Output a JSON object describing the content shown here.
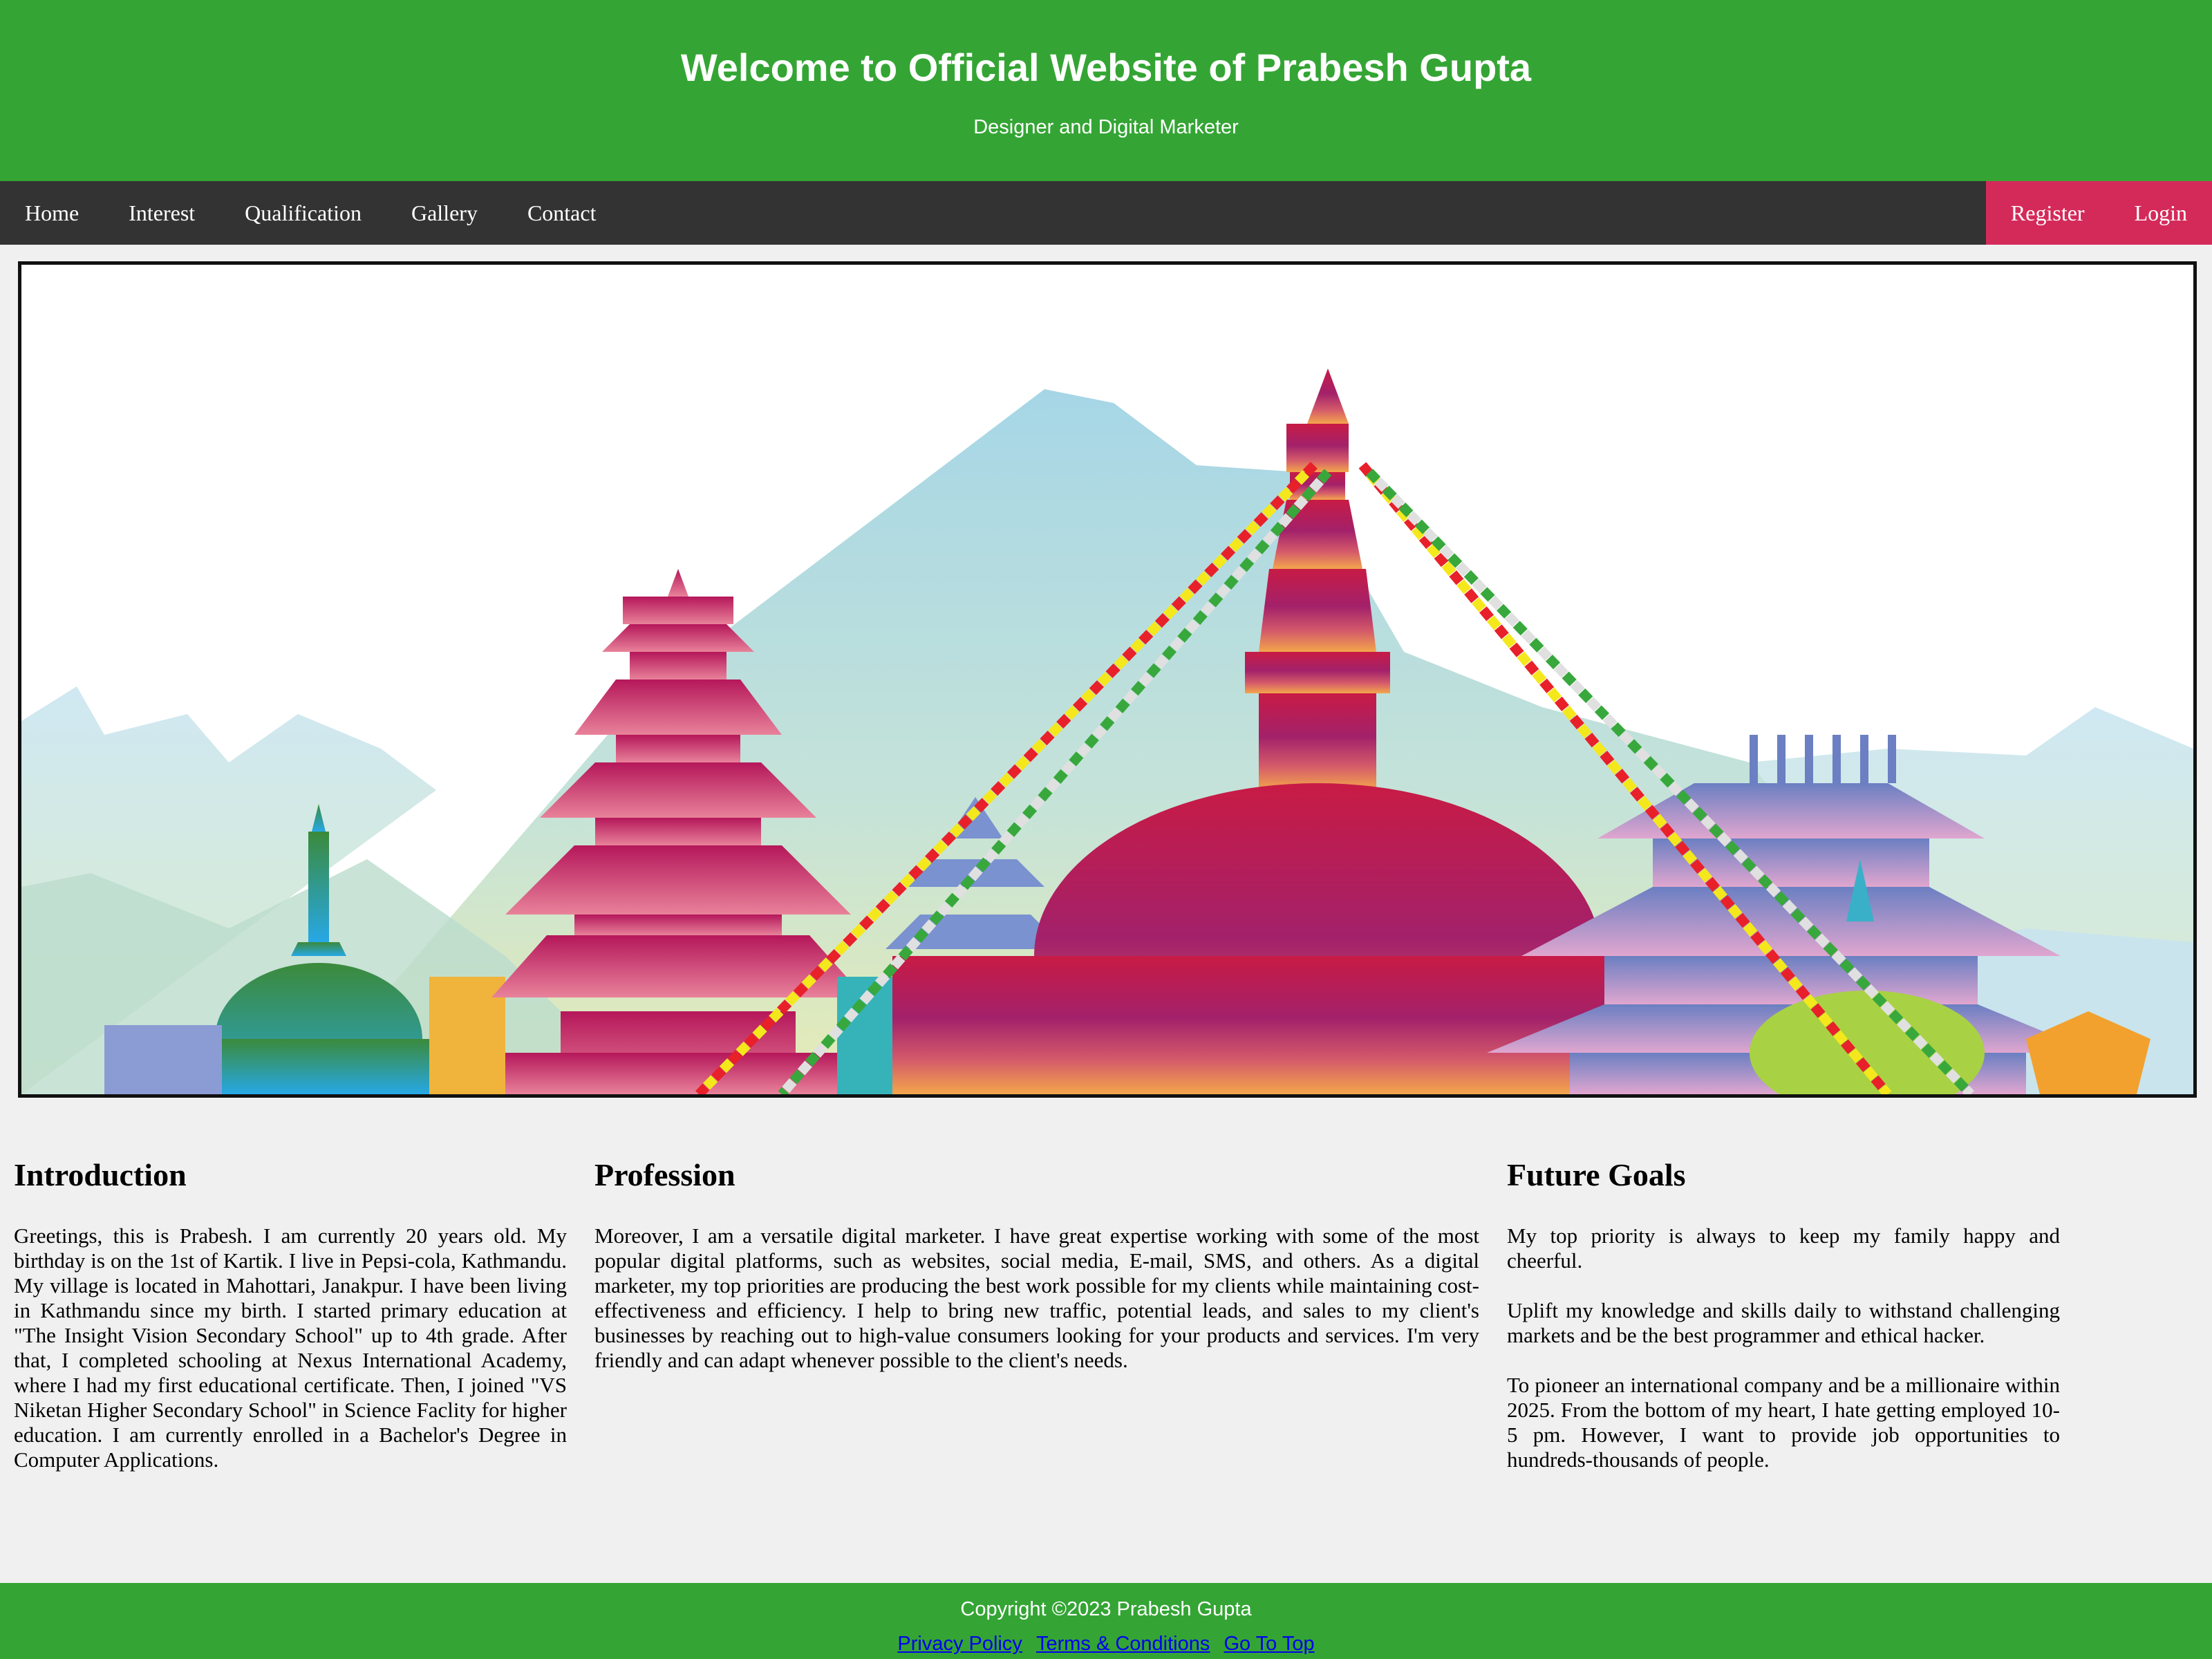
{
  "header": {
    "title": "Welcome to Official Website of Prabesh Gupta",
    "subtitle": "Designer and Digital Marketer"
  },
  "nav": {
    "left": [
      "Home",
      "Interest",
      "Qualification",
      "Gallery",
      "Contact"
    ],
    "right": [
      "Register",
      "Login"
    ]
  },
  "banner": {
    "icon": "kathmandu-skyline-illustration"
  },
  "sections": {
    "introduction": {
      "heading": "Introduction",
      "paragraphs": [
        "Greetings, this is Prabesh. I am currently 20 years old. My birthday is on the 1st of Kartik. I live in Pepsi-cola, Kathmandu. My village is located in Mahottari, Janakpur. I have been living in Kathmandu since my birth. I started primary education at \"The Insight Vision Secondary School\" up to 4th grade. After that, I completed schooling at Nexus International Academy, where I had my first educational certificate. Then, I joined \"VS Niketan Higher Secondary School\" in Science Faclity for higher education. I am currently enrolled in a Bachelor's Degree in Computer Applications."
      ]
    },
    "profession": {
      "heading": "Profession",
      "paragraphs": [
        "Moreover, I am a versatile digital marketer. I have great expertise working with some of the most popular digital platforms, such as websites, social media, E-mail, SMS, and others. As a digital marketer, my top priorities are producing the best work possible for my clients while maintaining cost-effectiveness and efficiency. I help to bring new traffic, potential leads, and sales to my client's businesses by reaching out to high-value consumers looking for your products and services. I'm very friendly and can adapt whenever possible to the client's needs."
      ]
    },
    "goals": {
      "heading": "Future Goals",
      "paragraphs": [
        "My top priority is always to keep my family happy and cheerful.",
        "Uplift my knowledge and skills daily to withstand challenging markets and be the best programmer and ethical hacker.",
        "To pioneer an international company and be a millionaire within 2025. From the bottom of my heart, I hate getting employed 10-5 pm. However, I want to provide job opportunities to hundreds-thousands of people."
      ]
    }
  },
  "footer": {
    "copyright": "Copyright ©2023 Prabesh Gupta",
    "links": [
      "Privacy Policy",
      "Terms & Conditions",
      "Go To Top"
    ]
  },
  "colors": {
    "header": "#34a534",
    "nav": "#333333",
    "nav_right": "#d42a5a"
  }
}
